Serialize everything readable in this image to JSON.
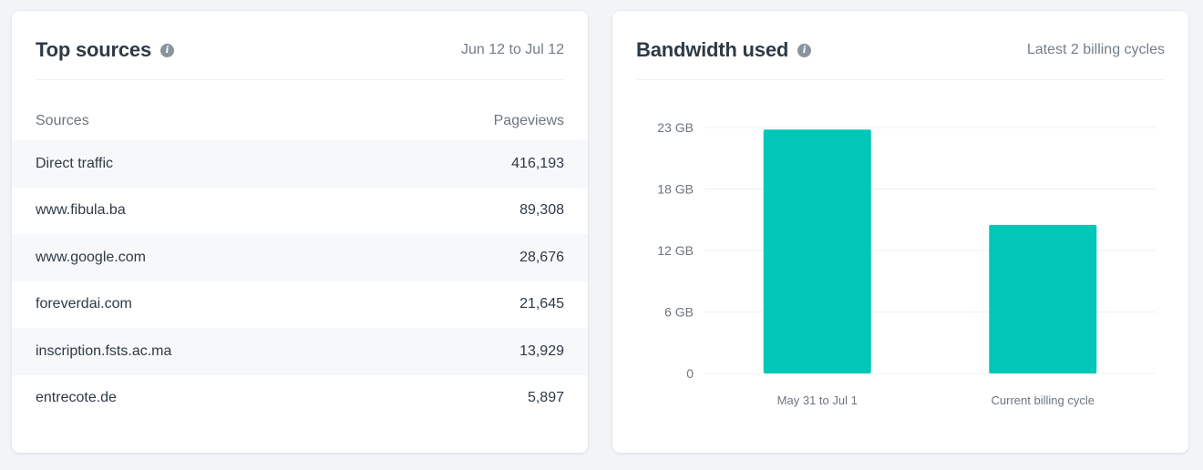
{
  "top_sources": {
    "title": "Top sources",
    "date_range": "Jun 12 to Jul 12",
    "columns": [
      "Sources",
      "Pageviews"
    ],
    "rows": [
      {
        "source": "Direct traffic",
        "pageviews": "416,193"
      },
      {
        "source": "www.fibula.ba",
        "pageviews": "89,308"
      },
      {
        "source": "www.google.com",
        "pageviews": "28,676"
      },
      {
        "source": "foreverdai.com",
        "pageviews": "21,645"
      },
      {
        "source": "inscription.fsts.ac.ma",
        "pageviews": "13,929"
      },
      {
        "source": "entrecote.de",
        "pageviews": "5,897"
      }
    ]
  },
  "bandwidth": {
    "title": "Bandwidth used",
    "subtitle": "Latest 2 billing cycles"
  },
  "chart_data": {
    "type": "bar",
    "categories": [
      "May 31 to Jul 1",
      "Current billing cycle"
    ],
    "values": [
      23.8,
      14.5
    ],
    "yticks": [
      {
        "value": 0,
        "label": "0"
      },
      {
        "value": 6,
        "label": "6 GB"
      },
      {
        "value": 12,
        "label": "12 GB"
      },
      {
        "value": 18,
        "label": "18 GB"
      },
      {
        "value": 24,
        "label": "23 GB"
      }
    ],
    "ylim": [
      0,
      24
    ],
    "grid": true,
    "bar_color": "#00c7b7",
    "grid_color": "#eef0f3"
  }
}
